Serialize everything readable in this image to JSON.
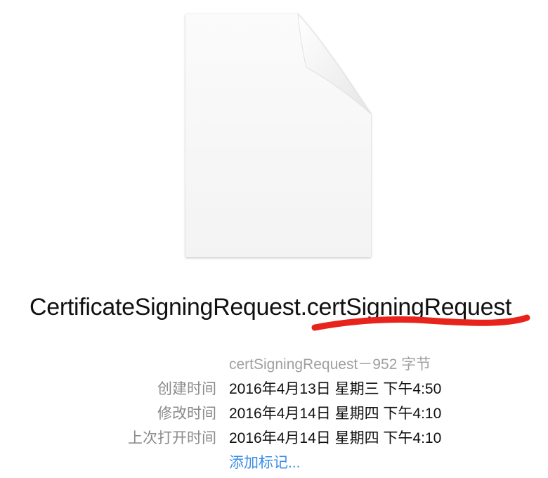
{
  "file": {
    "icon": "blank-document-icon",
    "name_base": "CertificateSigningRequest",
    "name_ext": ".certSigningRequest",
    "kind_line": "certSigningRequest－952 字节"
  },
  "info": {
    "created_label": "创建时间",
    "created_value": "2016年4月13日 星期三 下午4:50",
    "modified_label": "修改时间",
    "modified_value": "2016年4月14日 星期四 下午4:10",
    "opened_label": "上次打开时间",
    "opened_value": "2016年4月14日 星期四 下午4:10"
  },
  "tags": {
    "add_label": "添加标记..."
  },
  "colors": {
    "annotation_red": "#e8231b",
    "link_blue": "#3b8ee8",
    "label_gray": "#8a8a8a"
  }
}
